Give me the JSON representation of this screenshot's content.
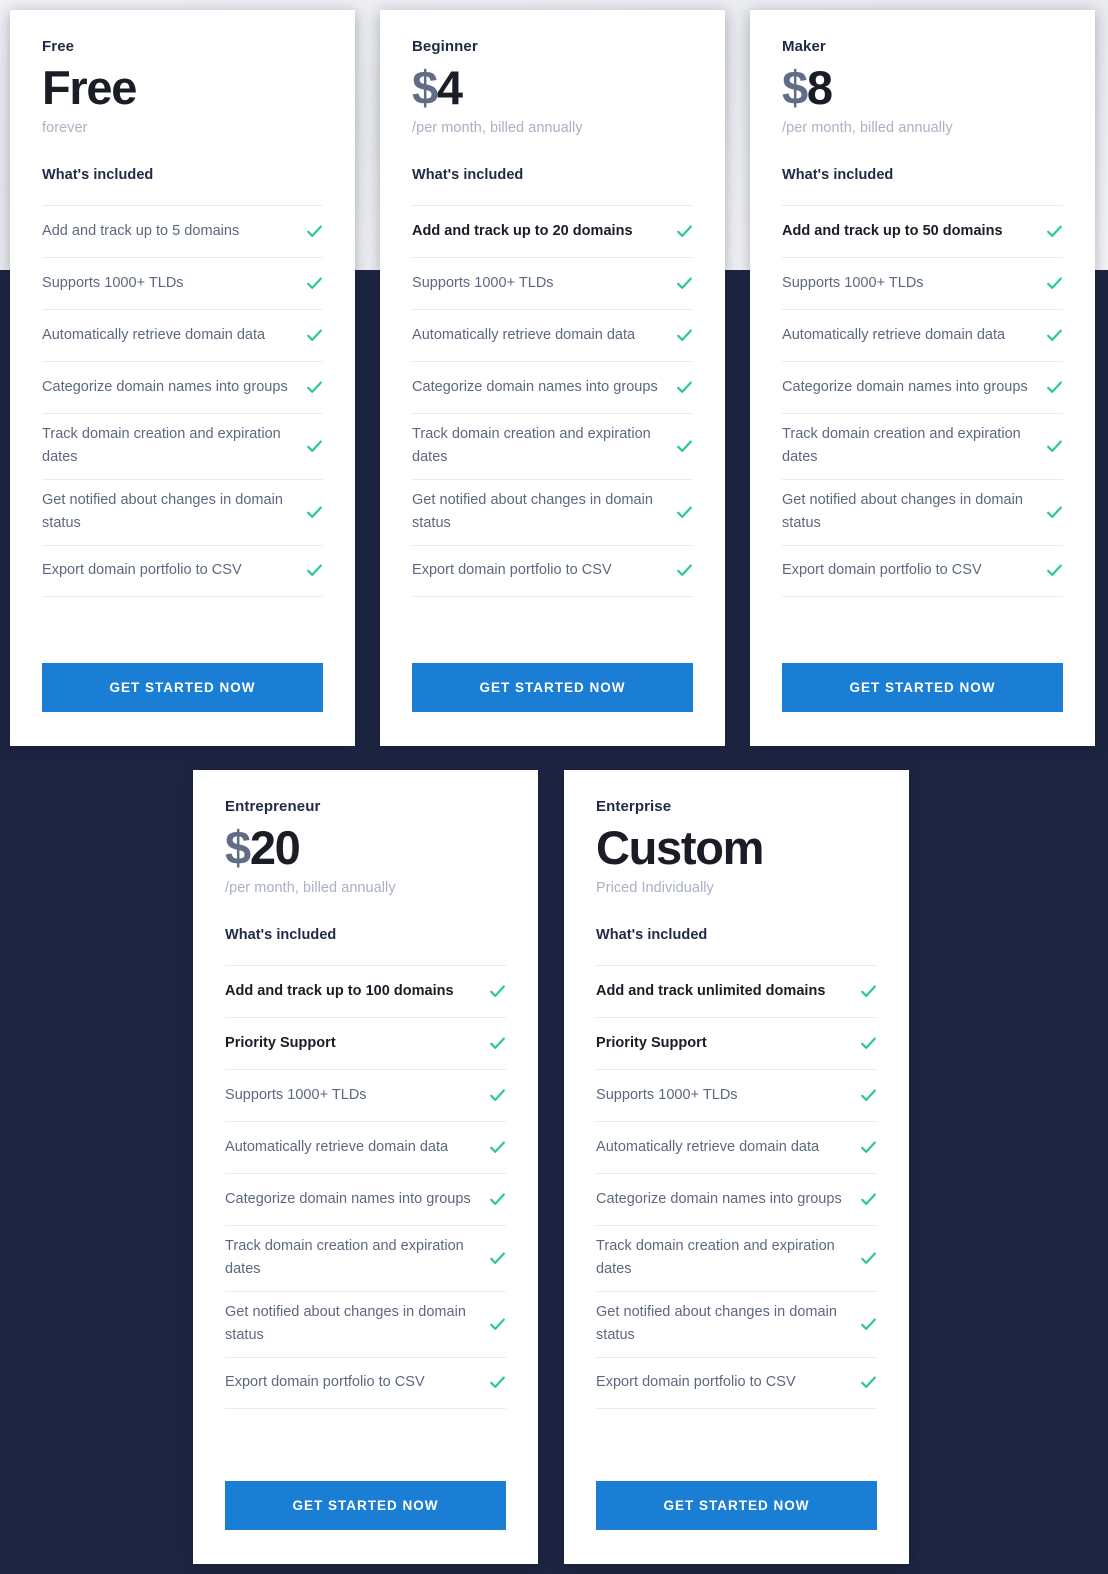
{
  "theme": {
    "page_background": "#1d2541",
    "top_band_background": "#eef0f4",
    "card_background": "#ffffff",
    "accent_button": "#1a7fd4",
    "check_color": "#2ec98d",
    "muted_text": "#5d687e",
    "price_currency_color": "#616d87"
  },
  "cta": {
    "label": "GET STARTED NOW"
  },
  "labels": {
    "included_title": "What's included",
    "check_icon_name": "check-icon"
  },
  "plans": [
    {
      "id": "free",
      "name": "Free",
      "price_currency": "",
      "price_amount": "Free",
      "price_note": "forever",
      "included_title": "What's included",
      "cta_label": "GET STARTED NOW",
      "features": [
        {
          "text": "Add and track up to 5 domains",
          "highlight": false,
          "checked": true
        },
        {
          "text": "Supports 1000+ TLDs",
          "highlight": false,
          "checked": true
        },
        {
          "text": "Automatically retrieve domain data",
          "highlight": false,
          "checked": true
        },
        {
          "text": "Categorize domain names into groups",
          "highlight": false,
          "checked": true
        },
        {
          "text": "Track domain creation and expiration dates",
          "highlight": false,
          "checked": true
        },
        {
          "text": "Get notified about changes in domain status",
          "highlight": false,
          "checked": true
        },
        {
          "text": "Export domain portfolio to CSV",
          "highlight": false,
          "checked": true
        }
      ]
    },
    {
      "id": "beginner",
      "name": "Beginner",
      "price_currency": "$",
      "price_amount": "4",
      "price_note": "/per month, billed annually",
      "included_title": "What's included",
      "cta_label": "GET STARTED NOW",
      "features": [
        {
          "text": "Add and track up to 20 domains",
          "highlight": true,
          "checked": true
        },
        {
          "text": "Supports 1000+ TLDs",
          "highlight": false,
          "checked": true
        },
        {
          "text": "Automatically retrieve domain data",
          "highlight": false,
          "checked": true
        },
        {
          "text": "Categorize domain names into groups",
          "highlight": false,
          "checked": true
        },
        {
          "text": "Track domain creation and expiration dates",
          "highlight": false,
          "checked": true
        },
        {
          "text": "Get notified about changes in domain status",
          "highlight": false,
          "checked": true
        },
        {
          "text": "Export domain portfolio to CSV",
          "highlight": false,
          "checked": true
        }
      ]
    },
    {
      "id": "maker",
      "name": "Maker",
      "price_currency": "$",
      "price_amount": "8",
      "price_note": "/per month, billed annually",
      "included_title": "What's included",
      "cta_label": "GET STARTED NOW",
      "features": [
        {
          "text": "Add and track up to 50 domains",
          "highlight": true,
          "checked": true
        },
        {
          "text": "Supports 1000+ TLDs",
          "highlight": false,
          "checked": true
        },
        {
          "text": "Automatically retrieve domain data",
          "highlight": false,
          "checked": true
        },
        {
          "text": "Categorize domain names into groups",
          "highlight": false,
          "checked": true
        },
        {
          "text": "Track domain creation and expiration dates",
          "highlight": false,
          "checked": true
        },
        {
          "text": "Get notified about changes in domain status",
          "highlight": false,
          "checked": true
        },
        {
          "text": "Export domain portfolio to CSV",
          "highlight": false,
          "checked": true
        }
      ]
    },
    {
      "id": "entrepreneur",
      "name": "Entrepreneur",
      "price_currency": "$",
      "price_amount": "20",
      "price_note": "/per month, billed annually",
      "included_title": "What's included",
      "cta_label": "GET STARTED NOW",
      "features": [
        {
          "text": "Add and track up to 100 domains",
          "highlight": true,
          "checked": true
        },
        {
          "text": "Priority Support",
          "highlight": true,
          "checked": true
        },
        {
          "text": "Supports 1000+ TLDs",
          "highlight": false,
          "checked": true
        },
        {
          "text": "Automatically retrieve domain data",
          "highlight": false,
          "checked": true
        },
        {
          "text": "Categorize domain names into groups",
          "highlight": false,
          "checked": true
        },
        {
          "text": "Track domain creation and expiration dates",
          "highlight": false,
          "checked": true
        },
        {
          "text": "Get notified about changes in domain status",
          "highlight": false,
          "checked": true
        },
        {
          "text": "Export domain portfolio to CSV",
          "highlight": false,
          "checked": true
        }
      ]
    },
    {
      "id": "enterprise",
      "name": "Enterprise",
      "price_currency": "",
      "price_amount": "Custom",
      "price_note": "Priced Individually",
      "included_title": "What's included",
      "cta_label": "GET STARTED NOW",
      "features": [
        {
          "text": "Add and track unlimited domains",
          "highlight": true,
          "checked": true
        },
        {
          "text": "Priority Support",
          "highlight": true,
          "checked": true
        },
        {
          "text": "Supports 1000+ TLDs",
          "highlight": false,
          "checked": true
        },
        {
          "text": "Automatically retrieve domain data",
          "highlight": false,
          "checked": true
        },
        {
          "text": "Categorize domain names into groups",
          "highlight": false,
          "checked": true
        },
        {
          "text": "Track domain creation and expiration dates",
          "highlight": false,
          "checked": true
        },
        {
          "text": "Get notified about changes in domain status",
          "highlight": false,
          "checked": true
        },
        {
          "text": "Export domain portfolio to CSV",
          "highlight": false,
          "checked": true
        }
      ]
    }
  ]
}
